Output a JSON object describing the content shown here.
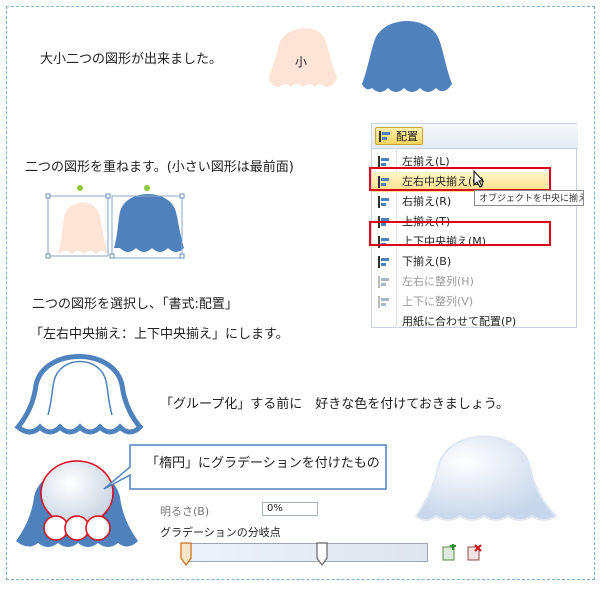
{
  "colors": {
    "peach": "#fde4d6",
    "blue": "#4f81bd",
    "red": "#e0001a",
    "frame": "#7fb0d6"
  },
  "texts": {
    "line1": "大小二つの図形が出来ました。",
    "small_label": "小",
    "line2": "二つの図形を重ねます。(小さい図形は最前面)",
    "line3": "二つの図形を選択し、「書式:配置」",
    "line4": "「左右中央揃え：上下中央揃え」にします。",
    "line5": "「グループ化」する前に　好きな色を付けておきましょう。",
    "callout": "「楕円」にグラデーションを付けたもの"
  },
  "menu": {
    "button_label": "配置",
    "items": [
      {
        "label": "左揃え(L)",
        "icon": "align-left-icon",
        "disabled": false
      },
      {
        "label": "左右中央揃え(C)",
        "icon": "align-center-icon",
        "disabled": false,
        "highlighted": true
      },
      {
        "label": "右揃え(R)",
        "icon": "align-right-icon",
        "disabled": false
      },
      {
        "label": "上揃え(T)",
        "icon": "align-top-icon",
        "disabled": false
      },
      {
        "label": "上下中央揃え(M)",
        "icon": "align-middle-icon",
        "disabled": false
      },
      {
        "label": "下揃え(B)",
        "icon": "align-bottom-icon",
        "disabled": false
      },
      {
        "label": "左右に整列(H)",
        "icon": "distribute-horizontal-icon",
        "disabled": true
      },
      {
        "label": "上下に整列(V)",
        "icon": "distribute-vertical-icon",
        "disabled": true
      },
      {
        "label": "用紙に合わせて配置(P)",
        "icon": "",
        "disabled": false
      }
    ],
    "tooltip": "オブジェクトを中央に揃える"
  },
  "gradient_panel": {
    "partial_label": "明るさ(B)",
    "spin_value": "0%",
    "stops_label": "グラデーションの分岐点"
  }
}
